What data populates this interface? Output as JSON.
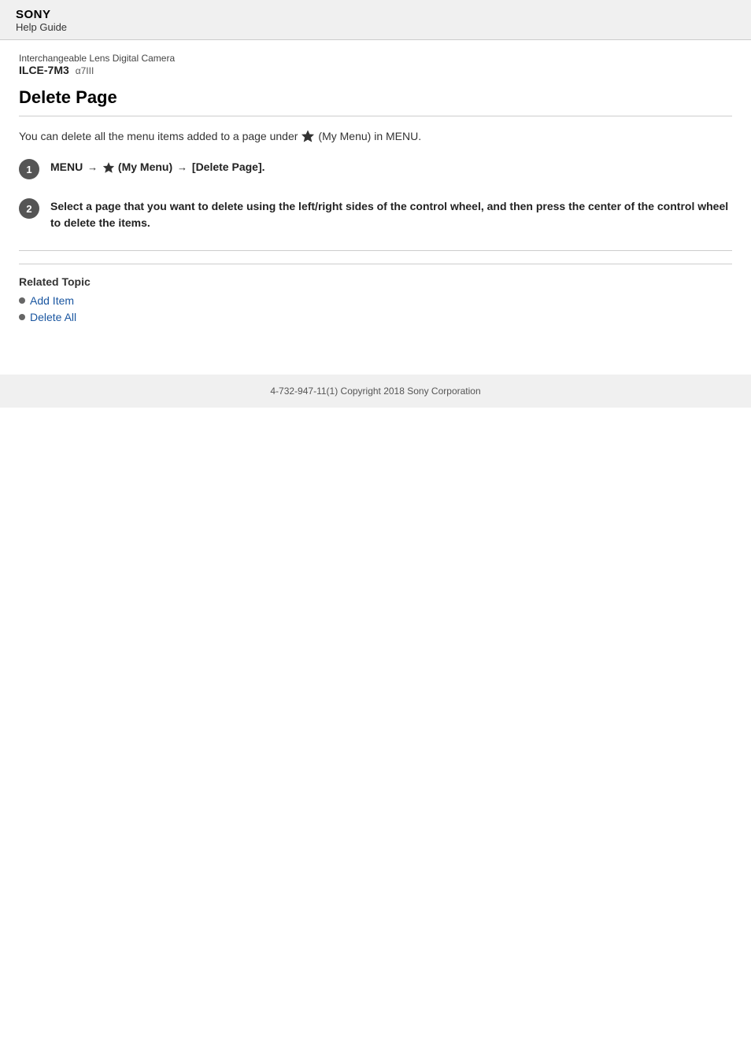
{
  "header": {
    "brand": "SONY",
    "subtitle": "Help Guide"
  },
  "camera": {
    "type": "Interchangeable Lens Digital Camera",
    "model": "ILCE-7M3",
    "variant": "α7III"
  },
  "page": {
    "title": "Delete Page"
  },
  "intro": {
    "before_star": "You can delete all the menu items added to a page under",
    "star_label": "(My Menu) in MENU.",
    "after_star": "(My Menu) in MENU."
  },
  "steps": [
    {
      "number": "1",
      "text": "MENU → ★ (My Menu) → [Delete Page]."
    },
    {
      "number": "2",
      "text": "Select a page that you want to delete using the left/right sides of the control wheel, and then press the center of the control wheel to delete the items."
    }
  ],
  "related": {
    "title": "Related Topic",
    "links": [
      {
        "label": "Add Item",
        "href": "#"
      },
      {
        "label": "Delete All",
        "href": "#"
      }
    ]
  },
  "footer": {
    "text": "4-732-947-11(1) Copyright 2018 Sony Corporation"
  }
}
